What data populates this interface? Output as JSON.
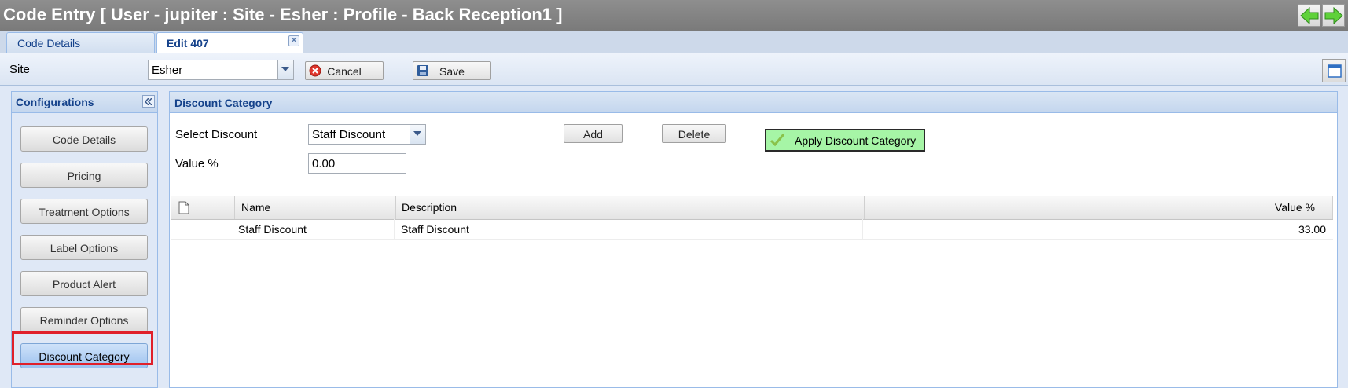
{
  "window": {
    "title": "Code Entry [ User - jupiter : Site - Esher : Profile - Back Reception1 ]",
    "back_icon": "arrow-left-icon",
    "forward_icon": "arrow-right-icon"
  },
  "tabs": [
    {
      "label": "Code Details",
      "active": false
    },
    {
      "label": "Edit 407",
      "active": true,
      "closable": true
    }
  ],
  "toolbar": {
    "site_label": "Site",
    "site_value": "Esher",
    "cancel_label": "Cancel",
    "save_label": "Save"
  },
  "sidebar": {
    "title": "Configurations",
    "items": [
      {
        "label": "Code Details"
      },
      {
        "label": "Pricing"
      },
      {
        "label": "Treatment Options"
      },
      {
        "label": "Label Options"
      },
      {
        "label": "Product Alert"
      },
      {
        "label": "Reminder Options"
      },
      {
        "label": "Discount Category",
        "selected": true
      }
    ]
  },
  "main": {
    "title": "Discount Category",
    "select_discount_label": "Select Discount",
    "select_discount_value": "Staff Discount",
    "value_label": "Value %",
    "value_input": "0.00",
    "add_label": "Add",
    "delete_label": "Delete",
    "apply_label": "Apply Discount Category",
    "grid": {
      "columns": [
        "Name",
        "Description",
        "Value %"
      ],
      "rows": [
        {
          "name": "Staff Discount",
          "description": "Staff Discount",
          "value": "33.00"
        }
      ]
    }
  },
  "colors": {
    "accent": "#15428b",
    "highlight": "#e0202a",
    "apply_bg": "#a6f5a6"
  }
}
